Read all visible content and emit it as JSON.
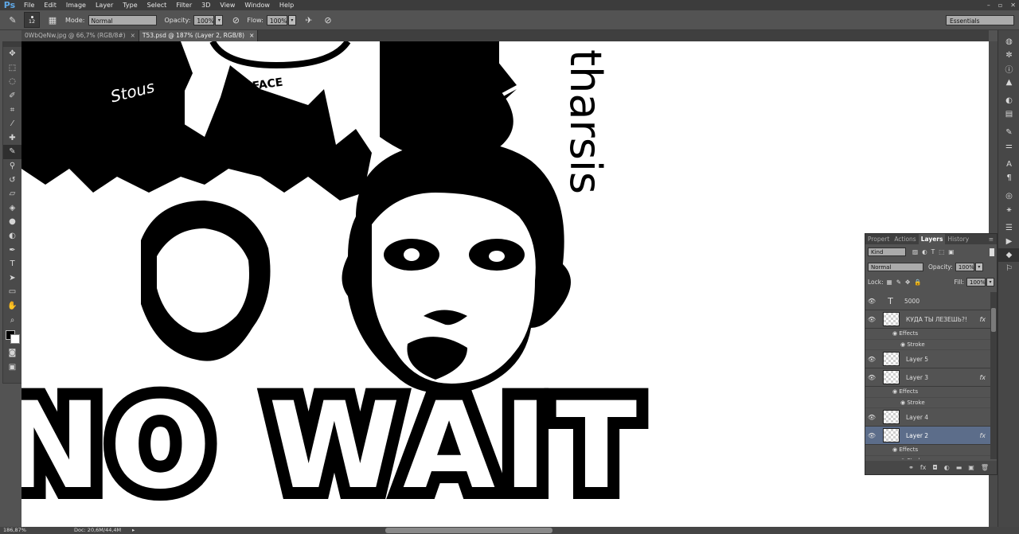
{
  "app": {
    "logo": "Ps"
  },
  "menu": [
    "File",
    "Edit",
    "Image",
    "Layer",
    "Type",
    "Select",
    "Filter",
    "3D",
    "View",
    "Window",
    "Help"
  ],
  "window_buttons": [
    "–",
    "▫",
    "✕"
  ],
  "options": {
    "brush_size": "12",
    "mode_label": "Mode:",
    "mode_value": "Normal",
    "opacity_label": "Opacity:",
    "opacity_value": "100%",
    "flow_label": "Flow:",
    "flow_value": "100%",
    "workspace": "Essentials"
  },
  "tabs": [
    {
      "label": "0WbQeNw.jpg @ 66,7% (RGB/8#)",
      "close": "×"
    },
    {
      "label": "T53.psd @ 187% (Layer 2, RGB/8)",
      "close": "×"
    }
  ],
  "canvas_text": {
    "vertical_word": "tharsis",
    "tag": "Stous",
    "bottom_text": "NO WAIT",
    "sign": "FACE"
  },
  "status": {
    "zoom": "186,87%",
    "doc": "Doc: 20,6M/44,4M"
  },
  "layers_panel": {
    "tabs": [
      "Propert",
      "Actions",
      "Layers",
      "History"
    ],
    "active_tab": "Layers",
    "filter_value": "Kind",
    "blend_mode": "Normal",
    "opacity_label": "Opacity:",
    "opacity_value": "100%",
    "lock_label": "Lock:",
    "fill_label": "Fill:",
    "fill_value": "100%",
    "effects_label": "Effects",
    "stroke_label": "Stroke",
    "fx_label": "fx",
    "layers": [
      {
        "name": "5000",
        "type": "text"
      },
      {
        "name": "КУДА ТЫ ЛЕЗЕШЬ?!",
        "type": "raster",
        "fx": true
      },
      {
        "name": "Layer 5",
        "type": "raster"
      },
      {
        "name": "Layer 3",
        "type": "raster",
        "fx": true
      },
      {
        "name": "Layer 4",
        "type": "raster"
      },
      {
        "name": "Layer 2",
        "type": "raster",
        "fx": true,
        "selected": true
      }
    ]
  }
}
